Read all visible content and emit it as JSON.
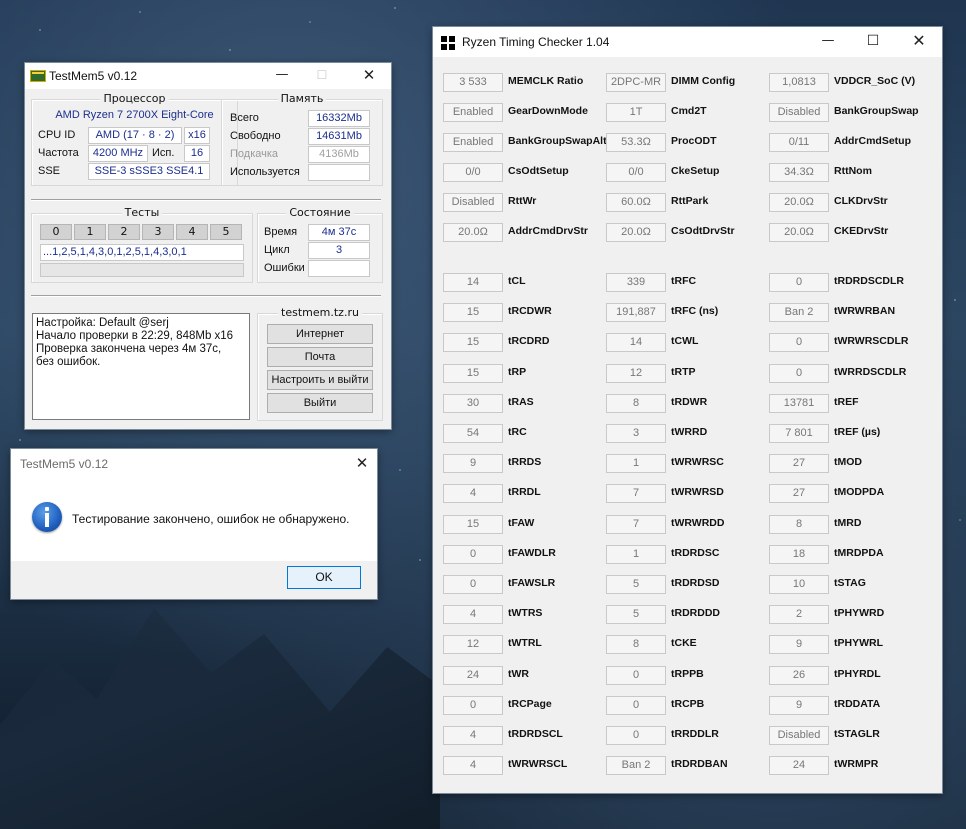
{
  "testmem": {
    "title": "TestMem5 v0.12",
    "processor": {
      "group": "Процессор",
      "name": "AMD Ryzen 7 2700X Eight-Core",
      "cpuid_label": "CPU ID",
      "cpuid_value": "AMD  (17 · 8 · 2)",
      "cpuid_x": "x16",
      "freq_label": "Частота",
      "freq_value": "4200 MHz",
      "used_label": "Исп.",
      "used_value": "16",
      "sse_label": "SSE",
      "sse_value": "SSE-3 sSSE3 SSE4.1"
    },
    "memory": {
      "group": "Память",
      "total_label": "Всего",
      "total_value": "16332Mb",
      "free_label": "Свободно",
      "free_value": "14631Mb",
      "swap_label": "Подкачка",
      "swap_value": "4136Mb",
      "used_label": "Используется",
      "used_value": ""
    },
    "tests": {
      "group": "Тесты",
      "numbers": [
        "0",
        "1",
        "2",
        "3",
        "4",
        "5"
      ],
      "sequence": "...1,2,5,1,4,3,0,1,2,5,1,4,3,0,1"
    },
    "state": {
      "group": "Состояние",
      "time_label": "Время",
      "time_value": "4м 37с",
      "cycle_label": "Цикл",
      "cycle_value": "3",
      "errors_label": "Ошибки",
      "errors_value": ""
    },
    "log_text": "Настройка: Default @serj\nНачало проверки в 22:29, 848Mb x16\nПроверка закончена через 4м 37с,\nбез ошибок.",
    "site": "testmem.tz.ru",
    "buttons": {
      "internet": "Интернет",
      "mail": "Почта",
      "configure": "Настроить и выйти",
      "exit": "Выйти"
    }
  },
  "dialog": {
    "title": "TestMem5 v0.12",
    "message": "Тестирование закончено, ошибок не обнаружено.",
    "ok": "OK"
  },
  "rtc": {
    "title": "Ryzen Timing Checker 1.04",
    "top_rows": [
      [
        {
          "v": "3 533",
          "l": "MEMCLK Ratio"
        },
        {
          "v": "2DPC-MR",
          "l": "DIMM Config"
        },
        {
          "v": "1,0813",
          "l": "VDDCR_SoC (V)"
        }
      ],
      [
        {
          "v": "Enabled",
          "l": "GearDownMode"
        },
        {
          "v": "1T",
          "l": "Cmd2T"
        },
        {
          "v": "Disabled",
          "l": "BankGroupSwap"
        }
      ],
      [
        {
          "v": "Enabled",
          "l": "BankGroupSwapAlt"
        },
        {
          "v": "53.3Ω",
          "l": "ProcODT"
        },
        {
          "v": "0/11",
          "l": "AddrCmdSetup"
        }
      ],
      [
        {
          "v": "0/0",
          "l": "CsOdtSetup"
        },
        {
          "v": "0/0",
          "l": "CkeSetup"
        },
        {
          "v": "34.3Ω",
          "l": "RttNom"
        }
      ],
      [
        {
          "v": "Disabled",
          "l": "RttWr"
        },
        {
          "v": "60.0Ω",
          "l": "RttPark"
        },
        {
          "v": "20.0Ω",
          "l": "CLKDrvStr"
        }
      ],
      [
        {
          "v": "20.0Ω",
          "l": "AddrCmdDrvStr"
        },
        {
          "v": "20.0Ω",
          "l": "CsOdtDrvStr"
        },
        {
          "v": "20.0Ω",
          "l": "CKEDrvStr"
        }
      ]
    ],
    "timing_rows": [
      [
        {
          "v": "14",
          "l": "tCL"
        },
        {
          "v": "339",
          "l": "tRFC"
        },
        {
          "v": "0",
          "l": "tRDRDSCDLR"
        }
      ],
      [
        {
          "v": "15",
          "l": "tRCDWR"
        },
        {
          "v": "191,887",
          "l": "tRFC (ns)"
        },
        {
          "v": "Ban 2",
          "l": "tWRWRBAN"
        }
      ],
      [
        {
          "v": "15",
          "l": "tRCDRD"
        },
        {
          "v": "14",
          "l": "tCWL"
        },
        {
          "v": "0",
          "l": "tWRWRSCDLR"
        }
      ],
      [
        {
          "v": "15",
          "l": "tRP"
        },
        {
          "v": "12",
          "l": "tRTP"
        },
        {
          "v": "0",
          "l": "tWRRDSCDLR"
        }
      ],
      [
        {
          "v": "30",
          "l": "tRAS"
        },
        {
          "v": "8",
          "l": "tRDWR"
        },
        {
          "v": "13781",
          "l": "tREF"
        }
      ],
      [
        {
          "v": "54",
          "l": "tRC"
        },
        {
          "v": "3",
          "l": "tWRRD"
        },
        {
          "v": "7 801",
          "l": "tREF (µs)"
        }
      ],
      [
        {
          "v": "9",
          "l": "tRRDS"
        },
        {
          "v": "1",
          "l": "tWRWRSC"
        },
        {
          "v": "27",
          "l": "tMOD"
        }
      ],
      [
        {
          "v": "4",
          "l": "tRRDL"
        },
        {
          "v": "7",
          "l": "tWRWRSD"
        },
        {
          "v": "27",
          "l": "tMODPDA"
        }
      ],
      [
        {
          "v": "15",
          "l": "tFAW"
        },
        {
          "v": "7",
          "l": "tWRWRDD"
        },
        {
          "v": "8",
          "l": "tMRD"
        }
      ],
      [
        {
          "v": "0",
          "l": "tFAWDLR"
        },
        {
          "v": "1",
          "l": "tRDRDSC"
        },
        {
          "v": "18",
          "l": "tMRDPDA"
        }
      ],
      [
        {
          "v": "0",
          "l": "tFAWSLR"
        },
        {
          "v": "5",
          "l": "tRDRDSD"
        },
        {
          "v": "10",
          "l": "tSTAG"
        }
      ],
      [
        {
          "v": "4",
          "l": "tWTRS"
        },
        {
          "v": "5",
          "l": "tRDRDDD"
        },
        {
          "v": "2",
          "l": "tPHYWRD"
        }
      ],
      [
        {
          "v": "12",
          "l": "tWTRL"
        },
        {
          "v": "8",
          "l": "tCKE"
        },
        {
          "v": "9",
          "l": "tPHYWRL"
        }
      ],
      [
        {
          "v": "24",
          "l": "tWR"
        },
        {
          "v": "0",
          "l": "tRPPB"
        },
        {
          "v": "26",
          "l": "tPHYRDL"
        }
      ],
      [
        {
          "v": "0",
          "l": "tRCPage"
        },
        {
          "v": "0",
          "l": "tRCPB"
        },
        {
          "v": "9",
          "l": "tRDDATA"
        }
      ],
      [
        {
          "v": "4",
          "l": "tRDRDSCL"
        },
        {
          "v": "0",
          "l": "tRRDDLR"
        },
        {
          "v": "Disabled",
          "l": "tSTAGLR"
        }
      ],
      [
        {
          "v": "4",
          "l": "tWRWRSCL"
        },
        {
          "v": "Ban 2",
          "l": "tRDRDBAN"
        },
        {
          "v": "24",
          "l": "tWRMPR"
        }
      ]
    ]
  }
}
